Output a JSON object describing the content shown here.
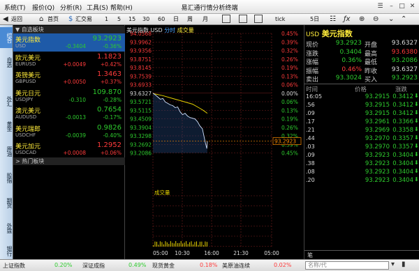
{
  "window": {
    "title": "易汇通行情分析终端",
    "menus": [
      "系统(T)",
      "报价(Q)",
      "分析(R)",
      "工具(S)",
      "帮助(H)"
    ]
  },
  "toolbar": {
    "back": "返回",
    "home": "首页",
    "exchange": "汇交易",
    "periods": [
      "1",
      "5",
      "15",
      "30",
      "60",
      "日",
      "周",
      "月"
    ],
    "tick": "tick",
    "days": "5日"
  },
  "vtabs": [
    "综合",
    "自选",
    "外汇",
    "黄金",
    "原油",
    "股指",
    "期货",
    "外盘",
    "银行"
  ],
  "list": {
    "group1": "▼ 自选板块",
    "group2": "> 热门板块",
    "rows": [
      {
        "name": "美元指数",
        "code": "USD",
        "price": "93.2923",
        "change": "-0.3404",
        "pct": "-0.36%",
        "dir": "dn",
        "selected": true
      },
      {
        "name": "欧元美元",
        "code": "EURUSD",
        "price": "1.1823",
        "change": "+0.0049",
        "pct": "+0.42%",
        "dir": "up",
        "selected": false
      },
      {
        "name": "英镑美元",
        "code": "GBPUSD",
        "price": "1.3463",
        "change": "+0.0050",
        "pct": "+0.37%",
        "dir": "up",
        "selected": false
      },
      {
        "name": "美元日元",
        "code": "USDJPY",
        "price": "109.870",
        "change": "-0.310",
        "pct": "-0.28%",
        "dir": "dn",
        "selected": false
      },
      {
        "name": "澳元美元",
        "code": "AUDUSD",
        "price": "0.7654",
        "change": "-0.0013",
        "pct": "-0.17%",
        "dir": "dn",
        "selected": false
      },
      {
        "name": "美元瑞郎",
        "code": "USDCHF",
        "price": "0.9826",
        "change": "-0.0039",
        "pct": "-0.40%",
        "dir": "dn",
        "selected": false
      },
      {
        "name": "美元加元",
        "code": "USDCAD",
        "price": "1.2952",
        "change": "+0.0008",
        "pct": "+0.06%",
        "dir": "up",
        "selected": false
      }
    ]
  },
  "chart": {
    "header_name": "美元指数 USD",
    "header_type": "分时",
    "header_vol": "成交量",
    "vol_label": "成交量",
    "price_ticks": [
      "94.0568",
      "93.9962",
      "93.9356",
      "93.8751",
      "93.8145",
      "93.7539",
      "93.6933",
      "93.6327",
      "93.5721",
      "93.5115",
      "93.4509",
      "93.3904",
      "93.3298",
      "93.2692",
      "93.2086"
    ],
    "pct_ticks": [
      "0.45%",
      "0.39%",
      "0.32%",
      "0.26%",
      "0.19%",
      "0.13%",
      "0.06%",
      "0.00%",
      "0.06%",
      "0.13%",
      "0.19%",
      "0.26%",
      "0.32%",
      "0.39%",
      "0.45%"
    ],
    "time_ticks": [
      "05:00",
      "10:30",
      "16:00",
      "21:30",
      "05:00"
    ],
    "current_price": "93.2923",
    "prev_close_label": "93.6327"
  },
  "quote": {
    "name_code": "USD",
    "name": "美元指数",
    "fields": [
      {
        "l1": "现价",
        "v1": "93.2923",
        "c1": "dn",
        "l2": "开盘",
        "v2": "93.6327",
        "c2": "fl"
      },
      {
        "l1": "涨跌",
        "v1": "0.3404",
        "c1": "dn",
        "l2": "最高",
        "v2": "93.6380",
        "c2": "up"
      },
      {
        "l1": "涨幅",
        "v1": "0.36%",
        "c1": "dn",
        "l2": "最低",
        "v2": "93.2086",
        "c2": "dn"
      },
      {
        "l1": "振幅",
        "v1": "0.46%",
        "c1": "up",
        "l2": "昨收",
        "v2": "93.6327",
        "c2": "fl"
      },
      {
        "l1": "卖出",
        "v1": "93.3024",
        "c1": "dn",
        "l2": "买入",
        "v2": "93.2923",
        "c2": "dn"
      }
    ],
    "tick_header": [
      "时间",
      "价格",
      "涨跌"
    ],
    "ticks": [
      {
        "t": "16:05",
        "p": "93.2915",
        "c": "0.3412"
      },
      {
        "t": "",
        "p": "93.2915",
        "c": "0.3412"
      },
      {
        "t": "",
        "p": "93.2915",
        "c": "0.3412"
      },
      {
        "t": "",
        "p": "93.2961",
        "c": "0.3366"
      },
      {
        "t": "",
        "p": "93.2969",
        "c": "0.3358"
      },
      {
        "t": "",
        "p": "93.2970",
        "c": "0.3357"
      },
      {
        "t": "",
        "p": "93.2970",
        "c": "0.3357"
      },
      {
        "t": "",
        "p": "93.2923",
        "c": "0.3404"
      },
      {
        "t": "",
        "p": "93.2923",
        "c": "0.3404"
      },
      {
        "t": "",
        "p": "93.2923",
        "c": "0.3404"
      },
      {
        "t": "",
        "p": "93.2923",
        "c": "0.3404"
      }
    ],
    "tick_seconds": [
      ".56",
      ".09",
      ".17",
      ".21",
      ".44",
      ".03",
      ".09",
      ".38",
      ".08",
      ".20"
    ],
    "footer_label": "笔"
  },
  "status": {
    "items": [
      {
        "name": "上证指数",
        "pct": "0.20%",
        "dir": "dn"
      },
      {
        "name": "深证成指",
        "pct": "0.49%",
        "dir": "dn"
      },
      {
        "name": "现货黄金",
        "pct": "0.18%",
        "dir": "up"
      },
      {
        "name": "美原油连续",
        "pct": "0.02%",
        "dir": "up"
      }
    ],
    "search_placeholder": "名称/代"
  },
  "colors": {
    "up": "#ff3b3b",
    "down": "#2ecc2e",
    "price_line": "#ffffff",
    "avg_line": "#e6d100",
    "grid": "#7a1e1e",
    "selected": "#1e5aa8"
  }
}
